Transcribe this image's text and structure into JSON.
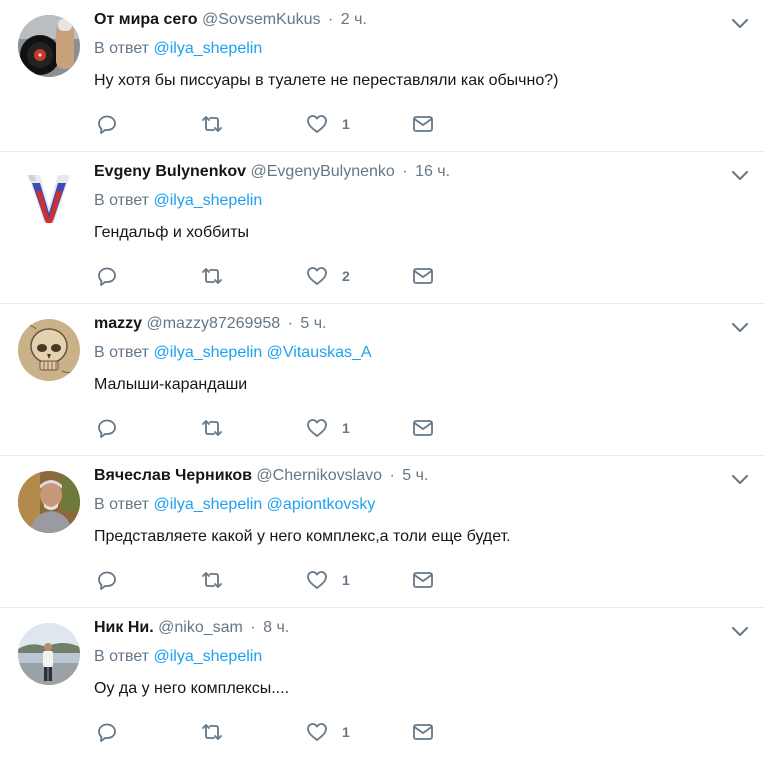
{
  "tweets": [
    {
      "fullname": "От мира сего",
      "username": "@SovsemKukus",
      "sep": "·",
      "time": "2 ч.",
      "reply_prefix": "В ответ",
      "mentions": [
        "@ilya_shepelin"
      ],
      "text": "Ну хотя бы писсуары в туалете не переставляли как обычно?)",
      "likes": "1",
      "avatar_icon": "vinyl-record-avatar"
    },
    {
      "fullname": "Evgeny Bulynenkov",
      "username": "@EvgenyBulynenko",
      "sep": "·",
      "time": "16 ч.",
      "reply_prefix": "В ответ",
      "mentions": [
        "@ilya_shepelin"
      ],
      "text": "Гендальф и хоббиты",
      "likes": "2",
      "avatar_icon": "tricolor-v-avatar"
    },
    {
      "fullname": "mazzy",
      "username": "@mazzy87269958",
      "sep": "·",
      "time": "5 ч.",
      "reply_prefix": "В ответ",
      "mentions": [
        "@ilya_shepelin",
        "@Vitauskas_A"
      ],
      "text": "Малыши-карандаши",
      "likes": "1",
      "avatar_icon": "skull-sketch-avatar"
    },
    {
      "fullname": "Вячеслав Черников",
      "username": "@Chernikovslavo",
      "sep": "·",
      "time": "5 ч.",
      "reply_prefix": "В ответ",
      "mentions": [
        "@ilya_shepelin",
        "@apiontkovsky"
      ],
      "text": "Представляете какой у него комплекс,а толи еще будет.",
      "likes": "1",
      "avatar_icon": "man-photo-avatar"
    },
    {
      "fullname": "Ник Ни.",
      "username": "@niko_sam",
      "sep": "·",
      "time": "8 ч.",
      "reply_prefix": "В ответ",
      "mentions": [
        "@ilya_shepelin"
      ],
      "text": "Оу да у него комплексы....",
      "likes": "1",
      "avatar_icon": "man-standing-photo-avatar"
    }
  ],
  "colors": {
    "text": "#14171a",
    "secondary": "#657786",
    "link": "#1da1f2",
    "divider": "#e6ecf0"
  }
}
